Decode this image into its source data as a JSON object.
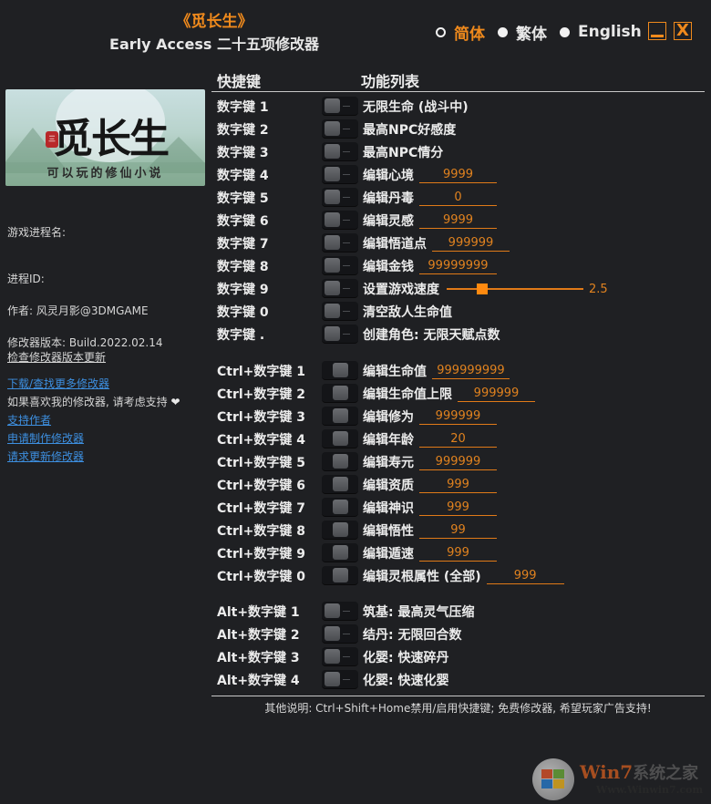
{
  "header": {
    "title": "《觅长生》",
    "subtitle": "Early Access 二十五项修改器"
  },
  "languages": [
    {
      "label": "简体",
      "selected": true
    },
    {
      "label": "繁体",
      "selected": false
    },
    {
      "label": "English",
      "selected": false
    }
  ],
  "window_controls": {
    "minimize_icon": "minimize-icon",
    "close_label": "X"
  },
  "banner": {
    "title": "觅长生",
    "seal": "三",
    "slogan": "可以玩的修仙小说"
  },
  "sidebar": {
    "process_name_label": "游戏进程名:",
    "process_id_label": "进程ID:",
    "author": "作者: 风灵月影@3DMGAME",
    "version": "修改器版本: Build.2022.02.14",
    "check_update": "检查修改器版本更新",
    "download_more": "下载/查找更多修改器",
    "support_text": "如果喜欢我的修改器, 请考虑支持",
    "heart": "❤",
    "support_author": "支持作者",
    "request_trainer": "申请制作修改器",
    "request_update": "请求更新修改器"
  },
  "columns": {
    "hotkey": "快捷键",
    "function": "功能列表"
  },
  "groups": [
    {
      "rows": [
        {
          "key": "数字键 1",
          "fn": "无限生命 (战斗中)"
        },
        {
          "key": "数字键 2",
          "fn": "最高NPC好感度"
        },
        {
          "key": "数字键 3",
          "fn": "最高NPC情分"
        },
        {
          "key": "数字键 4",
          "fn": "编辑心境",
          "value": "9999"
        },
        {
          "key": "数字键 5",
          "fn": "编辑丹毒",
          "value": "0"
        },
        {
          "key": "数字键 6",
          "fn": "编辑灵感",
          "value": "9999"
        },
        {
          "key": "数字键 7",
          "fn": "编辑悟道点",
          "value": "999999"
        },
        {
          "key": "数字键 8",
          "fn": "编辑金钱",
          "value": "99999999"
        },
        {
          "key": "数字键 9",
          "fn": "设置游戏速度",
          "slider": {
            "value": "2.5",
            "fraction": 0.26
          }
        },
        {
          "key": "数字键 0",
          "fn": "清空敌人生命值"
        },
        {
          "key": "数字键 .",
          "fn": "创建角色: 无限天赋点数"
        }
      ]
    },
    {
      "rows": [
        {
          "key": "Ctrl+数字键 1",
          "fn": "编辑生命值",
          "value": "999999999"
        },
        {
          "key": "Ctrl+数字键 2",
          "fn": "编辑生命值上限",
          "value": "999999"
        },
        {
          "key": "Ctrl+数字键 3",
          "fn": "编辑修为",
          "value": "999999"
        },
        {
          "key": "Ctrl+数字键 4",
          "fn": "编辑年龄",
          "value": "20"
        },
        {
          "key": "Ctrl+数字键 5",
          "fn": "编辑寿元",
          "value": "999999"
        },
        {
          "key": "Ctrl+数字键 6",
          "fn": "编辑资质",
          "value": "999"
        },
        {
          "key": "Ctrl+数字键 7",
          "fn": "编辑神识",
          "value": "999"
        },
        {
          "key": "Ctrl+数字键 8",
          "fn": "编辑悟性",
          "value": "99"
        },
        {
          "key": "Ctrl+数字键 9",
          "fn": "编辑遁速",
          "value": "999"
        },
        {
          "key": "Ctrl+数字键 0",
          "fn": "编辑灵根属性 (全部)",
          "value": "999"
        }
      ]
    },
    {
      "rows": [
        {
          "key": "Alt+数字键 1",
          "fn": "筑基: 最高灵气压缩"
        },
        {
          "key": "Alt+数字键 2",
          "fn": "结丹: 无限回合数"
        },
        {
          "key": "Alt+数字键 3",
          "fn": "化婴: 快速碎丹"
        },
        {
          "key": "Alt+数字键 4",
          "fn": "化婴: 快速化婴"
        }
      ]
    }
  ],
  "footer": "其他说明: Ctrl+Shift+Home禁用/启用快捷键; 免费修改器, 希望玩家广告支持!",
  "watermark": {
    "brand": "Win7",
    "brand_cn": "系统之家",
    "url": "Www.Winwin7.com"
  },
  "colors": {
    "accent": "#f08a1c",
    "background": "#1f2023",
    "link": "#3d8fe0"
  }
}
